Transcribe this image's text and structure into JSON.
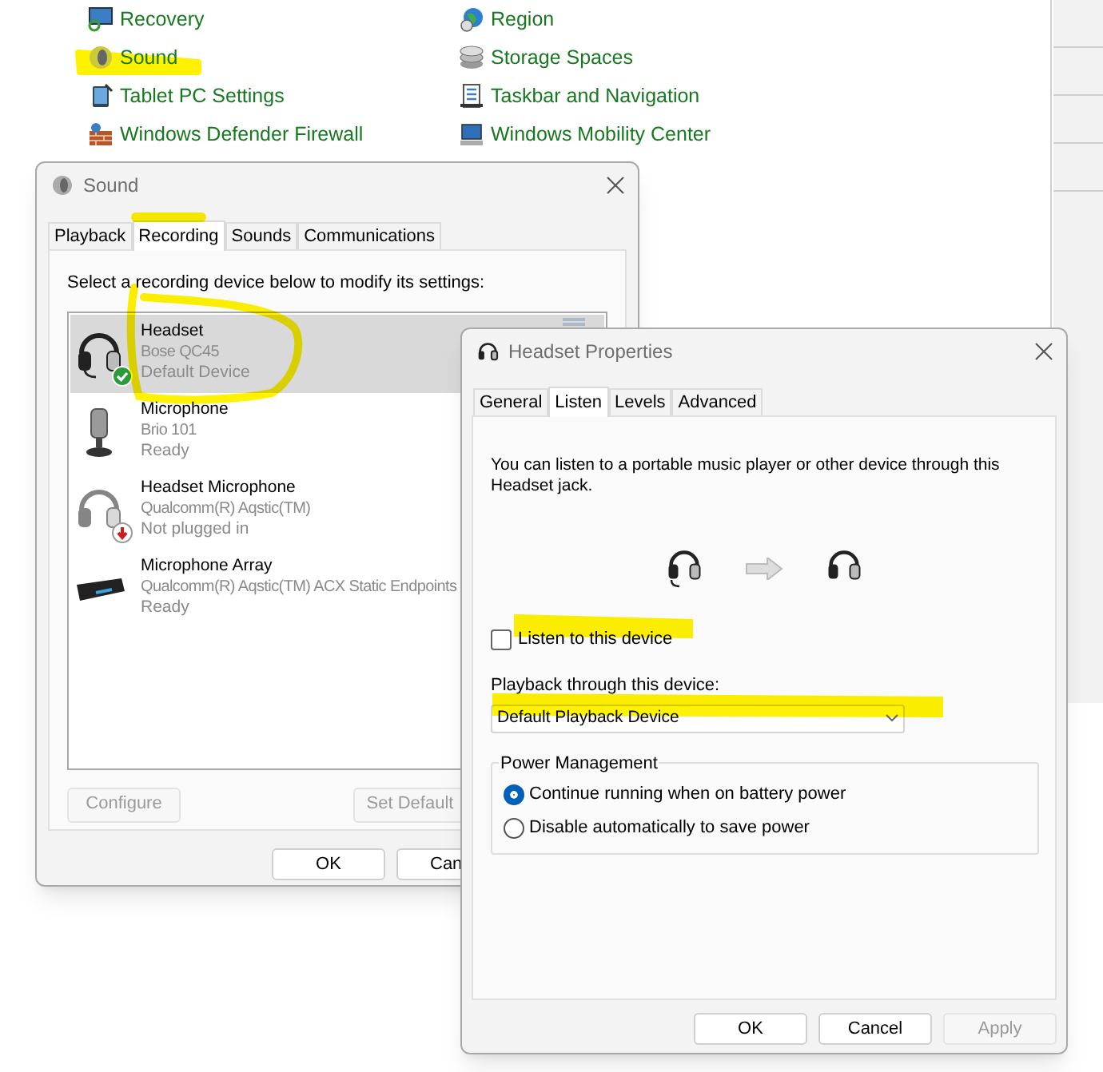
{
  "control_panel": {
    "left_links": [
      "Recovery",
      "Sound",
      "Tablet PC Settings",
      "Windows Defender Firewall"
    ],
    "right_links": [
      "Region",
      "Storage Spaces",
      "Taskbar and Navigation",
      "Windows Mobility Center"
    ]
  },
  "sound_dialog": {
    "title": "Sound",
    "tabs": [
      {
        "label": "Playback",
        "selected": false
      },
      {
        "label": "Recording",
        "selected": true
      },
      {
        "label": "Sounds",
        "selected": false
      },
      {
        "label": "Communications",
        "selected": false
      }
    ],
    "instruction": "Select a recording device below to modify its settings:",
    "devices": [
      {
        "name": "Headset",
        "detail": "Bose QC45",
        "status": "Default Device",
        "selected": true,
        "default": true,
        "unplugged": false
      },
      {
        "name": "Microphone",
        "detail": "Brio 101",
        "status": "Ready",
        "selected": false,
        "default": false,
        "unplugged": false
      },
      {
        "name": "Headset Microphone",
        "detail": "Qualcomm(R) Aqstic(TM)",
        "status": "Not plugged in",
        "selected": false,
        "default": false,
        "unplugged": true
      },
      {
        "name": "Microphone Array",
        "detail": "Qualcomm(R) Aqstic(TM) ACX Static Endpoints",
        "status": "Ready",
        "selected": false,
        "default": false,
        "unplugged": false
      }
    ],
    "buttons": [
      {
        "label": "Configure",
        "disabled": true
      },
      {
        "label": "Set Default",
        "disabled": true
      }
    ],
    "footer_buttons": [
      {
        "label": "OK",
        "disabled": false
      },
      {
        "label": "Can",
        "disabled": false
      }
    ]
  },
  "properties_dialog": {
    "title": "Headset Properties",
    "tabs": [
      {
        "label": "General",
        "selected": false
      },
      {
        "label": "Listen",
        "selected": true
      },
      {
        "label": "Levels",
        "selected": false
      },
      {
        "label": "Advanced",
        "selected": false
      }
    ],
    "description": "You can listen to a portable music player or other device through this Headset jack.",
    "listen_checkbox": {
      "label": "Listen to this device",
      "checked": false
    },
    "playback_label": "Playback through this device:",
    "playback_dropdown": {
      "value": "Default Playback Device"
    },
    "power_management": {
      "legend": "Power Management",
      "options": [
        {
          "label": "Continue running when on battery power",
          "selected": true
        },
        {
          "label": "Disable automatically to save power",
          "selected": false
        }
      ]
    },
    "footer_buttons": [
      {
        "label": "OK",
        "disabled": false
      },
      {
        "label": "Cancel",
        "disabled": false
      },
      {
        "label": "Apply",
        "disabled": true
      }
    ]
  }
}
